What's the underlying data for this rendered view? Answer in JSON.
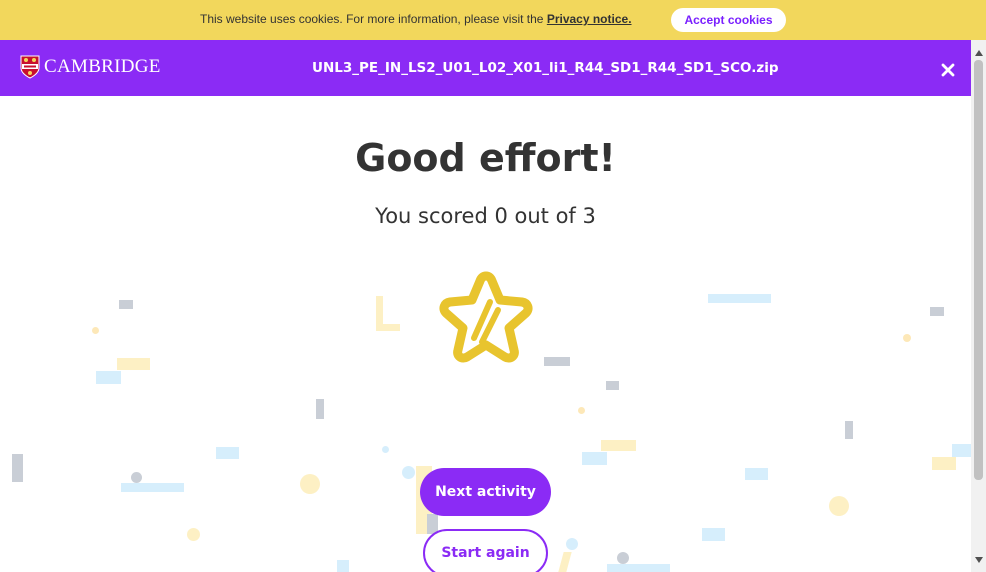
{
  "cookie_banner": {
    "text": "This website uses cookies. For more information, please visit the ",
    "link_text": "Privacy notice.",
    "accept_label": "Accept cookies"
  },
  "header": {
    "logo_text": "CAMBRIDGE",
    "title": "UNL3_PE_IN_LS2_U01_L02_X01_li1_R44_SD1_R44_SD1_SCO.zip",
    "close_icon": "close-icon"
  },
  "result": {
    "heading": "Good effort!",
    "score_text": "You scored 0 out of 3",
    "star_icon": "star-icon"
  },
  "actions": {
    "next_label": "Next activity",
    "again_label": "Start again"
  },
  "colors": {
    "brand_purple": "#8b2bf5",
    "cookie_yellow": "#f2d75c",
    "star_yellow": "#e8c42e"
  }
}
